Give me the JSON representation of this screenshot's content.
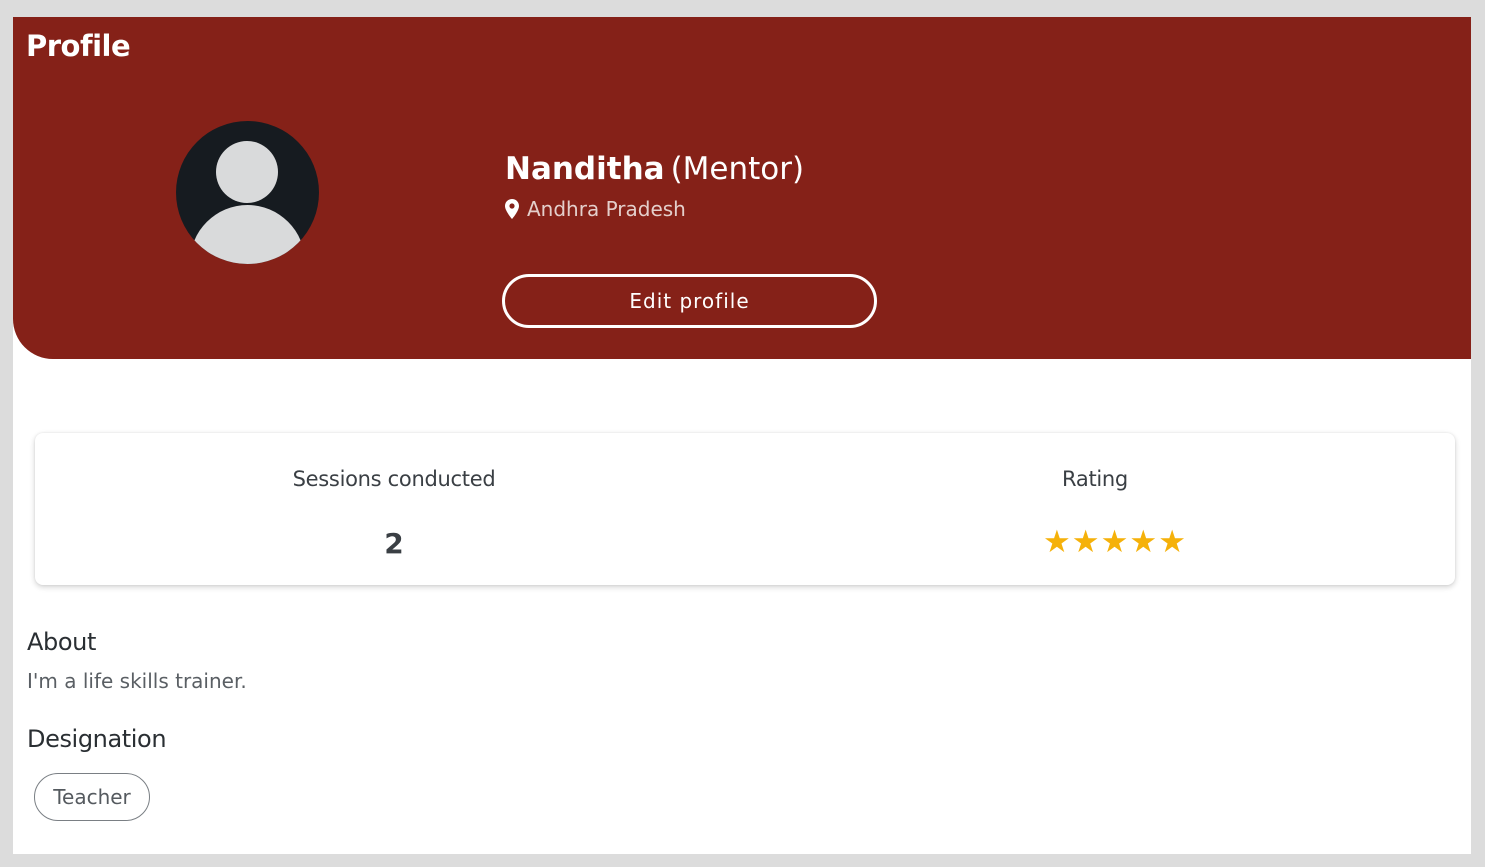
{
  "header": {
    "title": "Profile",
    "background_color": "#852118"
  },
  "profile": {
    "name": "Nanditha",
    "role": "(Mentor)",
    "location": "Andhra Pradesh",
    "edit_button_label": "Edit profile",
    "avatar_icon": "person-avatar-icon",
    "location_icon": "location-pin-icon"
  },
  "stats": {
    "sessions_label": "Sessions conducted",
    "sessions_value": "2",
    "rating_label": "Rating",
    "rating_value": 5,
    "rating_max": 5,
    "star_glyph": "★",
    "star_color": "#f5b10a"
  },
  "about": {
    "title": "About",
    "text": "I'm a life skills trainer."
  },
  "designation": {
    "title": "Designation",
    "chips": [
      "Teacher"
    ]
  }
}
